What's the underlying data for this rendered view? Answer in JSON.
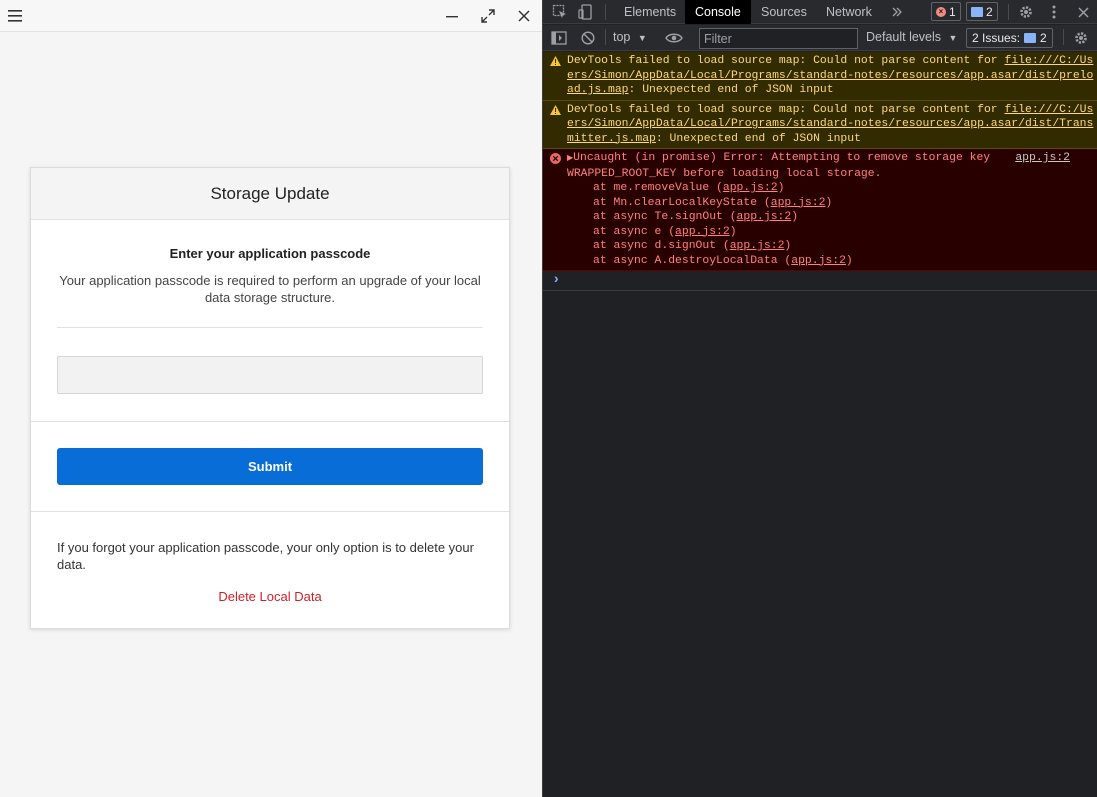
{
  "app": {
    "title_bar": {
      "menu_icon": "hamburger-icon",
      "minimize_icon": "minimize-icon",
      "maximize_icon": "maximize-icon",
      "close_icon": "close-icon"
    },
    "dialog": {
      "title": "Storage Update",
      "subtitle": "Enter your application passcode",
      "description": "Your application passcode is required to perform an upgrade of your local data storage structure.",
      "passcode_value": "",
      "submit_label": "Submit",
      "forgot_text": "If you forgot your application passcode, your only option is to delete your data.",
      "delete_label": "Delete Local Data"
    },
    "colors": {
      "primary": "#086dd6",
      "danger": "#cc2128"
    }
  },
  "devtools": {
    "tabs": [
      {
        "label": "Elements"
      },
      {
        "label": "Console",
        "active": true
      },
      {
        "label": "Sources"
      },
      {
        "label": "Network"
      }
    ],
    "more_tabs_icon": "double-chevron-icon",
    "error_count": "1",
    "message_count": "2",
    "toolbar": {
      "context": "top",
      "filter_placeholder": "Filter",
      "levels": "Default levels",
      "issues_label": "2 Issues:",
      "issues_count": "2"
    },
    "messages": [
      {
        "level": "warning",
        "prefix": "DevTools failed to load source map: Could not parse content for ",
        "link": "file:///C:/Users/Simon/AppData/Local/Programs/standard-notes/resources/app.asar/dist/preload.js.map",
        "suffix": ": Unexpected end of JSON input"
      },
      {
        "level": "warning",
        "prefix": "DevTools failed to load source map: Could not parse content for ",
        "link": "file:///C:/Users/Simon/AppData/Local/Programs/standard-notes/resources/app.asar/dist/Transmitter.js.map",
        "suffix": ": Unexpected end of JSON input"
      },
      {
        "level": "error",
        "source": "app.js:2",
        "message": "Uncaught (in promise) Error: Attempting to remove storage key WRAPPED_ROOT_KEY before loading local storage.",
        "stack": [
          {
            "text": "at me.removeValue (",
            "link": "app.js:2"
          },
          {
            "text": "at Mn.clearLocalKeyState (",
            "link": "app.js:2"
          },
          {
            "text": "at async Te.signOut (",
            "link": "app.js:2"
          },
          {
            "text": "at async e (",
            "link": "app.js:2"
          },
          {
            "text": "at async d.signOut (",
            "link": "app.js:2"
          },
          {
            "text": "at async A.destroyLocalData (",
            "link": "app.js:2"
          }
        ]
      }
    ]
  }
}
